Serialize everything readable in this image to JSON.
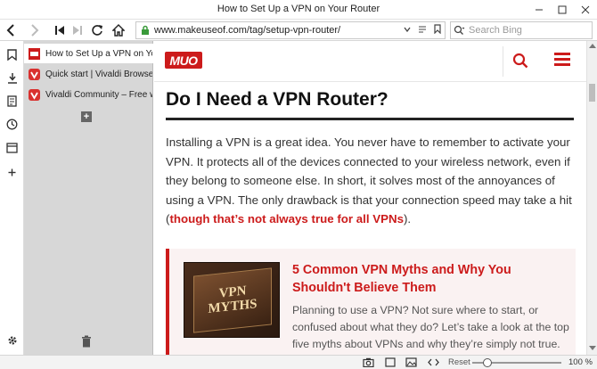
{
  "window": {
    "title": "How to Set Up a VPN on Your Router"
  },
  "address_bar": {
    "url": "www.makeuseof.com/tag/setup-vpn-router/",
    "search_placeholder": "Search Bing"
  },
  "tabs": [
    {
      "label": "How to Set Up a VPN on Your Router",
      "active": true,
      "favicon": "muo-favicon"
    },
    {
      "label": "Quick start | Vivaldi Browser",
      "active": false,
      "favicon": "vivaldi-favicon"
    },
    {
      "label": "Vivaldi Community – Free web",
      "active": false,
      "favicon": "vivaldi-favicon"
    }
  ],
  "tab_panel": {
    "new_tab_symbol": "+"
  },
  "site": {
    "logo_text": "MUO"
  },
  "article": {
    "heading": "Do I Need a VPN Router?",
    "para_text": "Installing a VPN is a great idea. You never have to remember to activate your VPN. It protects all of the devices connected to your wireless network, even if they belong to someone else. In short, it solves most of the annoyances of using a VPN. The only drawback is that your connection speed may take a hit (",
    "para_link": "though that’s not always true for all VPNs",
    "para_end": ")."
  },
  "related": {
    "thumb_text_1": "VPN",
    "thumb_text_2": "MYTHS",
    "title": "5 Common VPN Myths and Why You Shouldn't Believe Them",
    "description": "Planning to use a VPN? Not sure where to start, or confused about what they do? Let’s take a look at the top five myths about VPNs and why they’re simply not true."
  },
  "status_bar": {
    "reset_label": "Reset",
    "zoom_label": "100 %",
    "zoom_fraction": 0.17
  },
  "colors": {
    "accent": "#cc1b1b",
    "tab_panel_bg": "#d7d7d7"
  }
}
